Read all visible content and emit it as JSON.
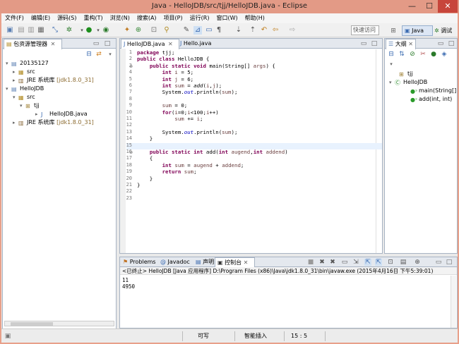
{
  "window": {
    "title": "Java - HelloJDB/src/tjj/HelloJDB.java - Eclipse",
    "minimize": "—",
    "maximize": "☐",
    "close": "✕"
  },
  "menu": [
    "文件(F)",
    "编辑(E)",
    "源码(S)",
    "重构(T)",
    "浏览(N)",
    "搜索(A)",
    "项目(P)",
    "运行(R)",
    "窗口(W)",
    "帮助(H)"
  ],
  "toolbar": {
    "quick_access": "快速访问",
    "perspective_java": "Java",
    "perspective_debug": "调试"
  },
  "package_explorer": {
    "tab": "包资源管理器",
    "tree": [
      {
        "label": "20135127",
        "twisty": "▾",
        "icon": "project"
      },
      {
        "label": "src",
        "twisty": "▸",
        "icon": "src-folder"
      },
      {
        "label": "JRE 系统库",
        "suffix": "[jdk1.8.0_31]",
        "twisty": "▸",
        "icon": "library"
      },
      {
        "label": "HelloJDB",
        "twisty": "▾",
        "icon": "project"
      },
      {
        "label": "src",
        "twisty": "▾",
        "icon": "src-folder"
      },
      {
        "label": "tjj",
        "twisty": "▾",
        "icon": "package"
      },
      {
        "label": "HelloJDB.java",
        "twisty": "▸",
        "icon": "java-file"
      },
      {
        "label": "JRE 系统库",
        "suffix": "[jdk1.8.0_31]",
        "twisty": "▸",
        "icon": "library"
      }
    ]
  },
  "editor": {
    "tabs": [
      {
        "label": "HelloJDB.java",
        "active": true
      },
      {
        "label": "Hello.java",
        "active": false
      }
    ],
    "line_numbers": [
      "1",
      "2",
      "3",
      "4",
      "5",
      "6",
      "7",
      "8",
      "9",
      "10",
      "11",
      "12",
      "13",
      "14",
      "15",
      "16",
      "17",
      "18",
      "19",
      "20",
      "21",
      "22",
      "23"
    ]
  },
  "outline": {
    "tab": "大纲",
    "items": [
      {
        "label": "tjj",
        "icon": "package"
      },
      {
        "label": "HelloJDB",
        "icon": "class"
      },
      {
        "label": "main(String[]",
        "icon": "method-static"
      },
      {
        "label": "add(int, int)",
        "icon": "method-static"
      }
    ]
  },
  "console": {
    "tabs": [
      "Problems",
      "Javadoc",
      "声明",
      "控制台"
    ],
    "header": "<已终止> HelloJDB [Java 应用程序] D:\\Program Files (x86)\\Java\\jdk1.8.0_31\\bin\\javaw.exe (2015年4月16日 下午5:39:01)",
    "output": [
      "11",
      "4950"
    ]
  },
  "status": {
    "writable": "可写",
    "insert_mode": "智能插入",
    "position": "15 : 5"
  },
  "colors": {
    "titlebar": "#e39a86",
    "keyword": "#7f0055",
    "field": "#0000c0",
    "current_line": "#e8f2fe"
  }
}
